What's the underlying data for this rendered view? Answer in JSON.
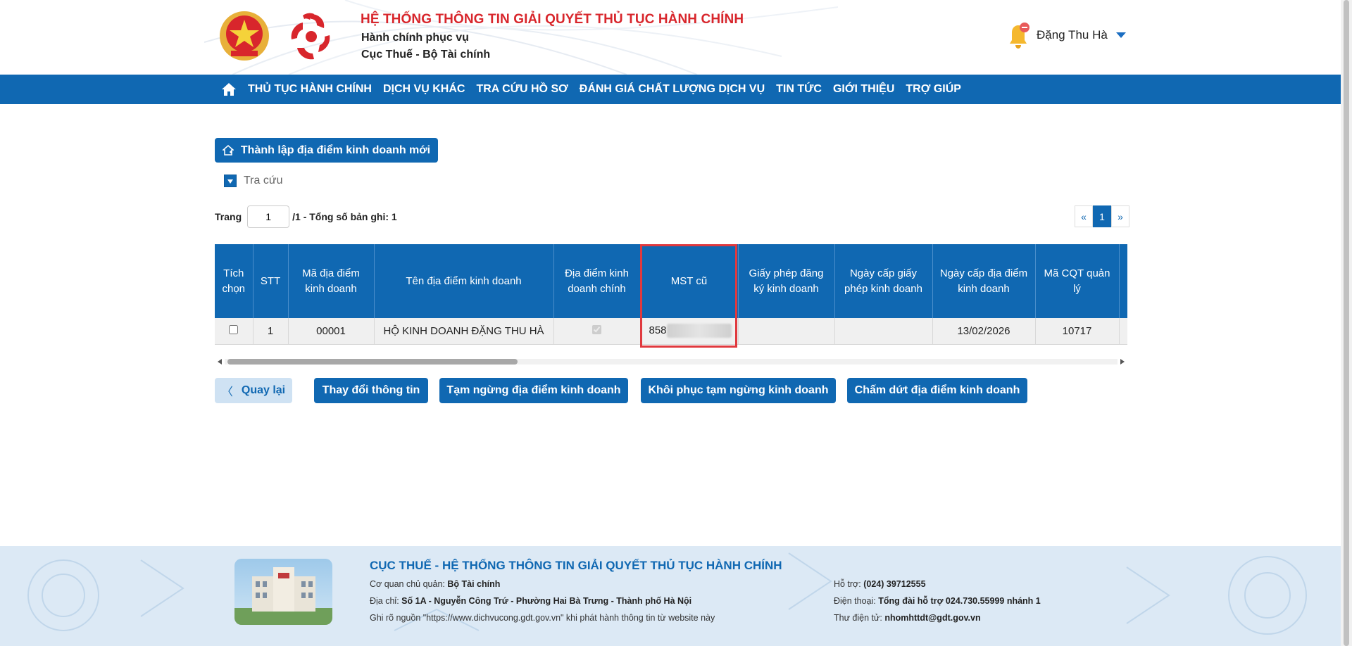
{
  "header": {
    "title": "HỆ THỐNG THÔNG TIN GIẢI QUYẾT THỦ TỤC HÀNH CHÍNH",
    "subtitle1": "Hành chính phục vụ",
    "subtitle2": "Cục Thuế - Bộ Tài chính",
    "user_name": "Đặng Thu Hà",
    "icons": [
      "national-emblem",
      "tax-logo",
      "bell-icon",
      "chevron-down-icon"
    ]
  },
  "nav": {
    "items": [
      {
        "label": "THỦ TỤC HÀNH CHÍNH"
      },
      {
        "label": "DỊCH VỤ KHÁC"
      },
      {
        "label": "TRA CỨU HỒ SƠ"
      },
      {
        "label": "ĐÁNH GIÁ CHẤT LƯỢNG DỊCH VỤ"
      },
      {
        "label": "TIN TỨC"
      },
      {
        "label": "GIỚI THIỆU"
      },
      {
        "label": "TRỢ GIÚP"
      }
    ]
  },
  "actions": {
    "new_label": "Thành lập địa điểm kinh doanh mới",
    "search_label": "Tra cứu"
  },
  "pager": {
    "page_label": "Trang",
    "page_value": "1",
    "total_text": "/1 - Tổng số bản ghi: 1",
    "prev": "«",
    "current": "1",
    "next": "»"
  },
  "table": {
    "headers": [
      "Tích chọn",
      "STT",
      "Mã địa điểm kinh doanh",
      "Tên địa điểm kinh doanh",
      "Địa điểm kinh doanh chính",
      "MST cũ",
      "Giấy phép đăng ký kinh doanh",
      "Ngày cấp giấy phép kinh doanh",
      "Ngày cấp địa điểm kinh doanh",
      "Mã CQT quản lý"
    ],
    "rows": [
      {
        "stt": "1",
        "code": "00001",
        "name": "HỘ KINH DOANH ĐẶNG THU HÀ",
        "mst_prefix": "858",
        "license": "",
        "license_date": "",
        "location_date": "13/02/2026",
        "cqt_code": "10717"
      }
    ]
  },
  "buttons": {
    "back": "Quay lại",
    "back_chevron": "〈",
    "change_info": "Thay đổi thông tin",
    "suspend": "Tạm ngừng địa điểm kinh doanh",
    "resume": "Khôi phục tạm ngừng kinh doanh",
    "terminate": "Chấm dứt địa điểm kinh doanh"
  },
  "footer": {
    "title": "CỤC THUẾ - HỆ THỐNG THÔNG TIN GIẢI QUYẾT THỦ TỤC HÀNH CHÍNH",
    "agency_label": "Cơ quan chủ quản:",
    "agency": "Bộ Tài chính",
    "address_label": "Địa chỉ:",
    "address": "Số 1A - Nguyễn Công Trứ - Phường Hai Bà Trưng - Thành phố Hà Nội",
    "source_note": "Ghi rõ nguồn \"https://www.dichvucong.gdt.gov.vn\" khi phát hành thông tin từ website này",
    "support_label": "Hỗ trợ:",
    "support": "(024) 39712555",
    "phone_label": "Điện thoại:",
    "phone": "Tổng đài hỗ trợ 024.730.55999 nhánh 1",
    "email_label": "Thư điện tử:",
    "email": "nhomhttdt@gdt.gov.vn"
  },
  "colors": {
    "primary": "#1068b2",
    "title_red": "#d8262c",
    "highlight": "#e0393e"
  }
}
